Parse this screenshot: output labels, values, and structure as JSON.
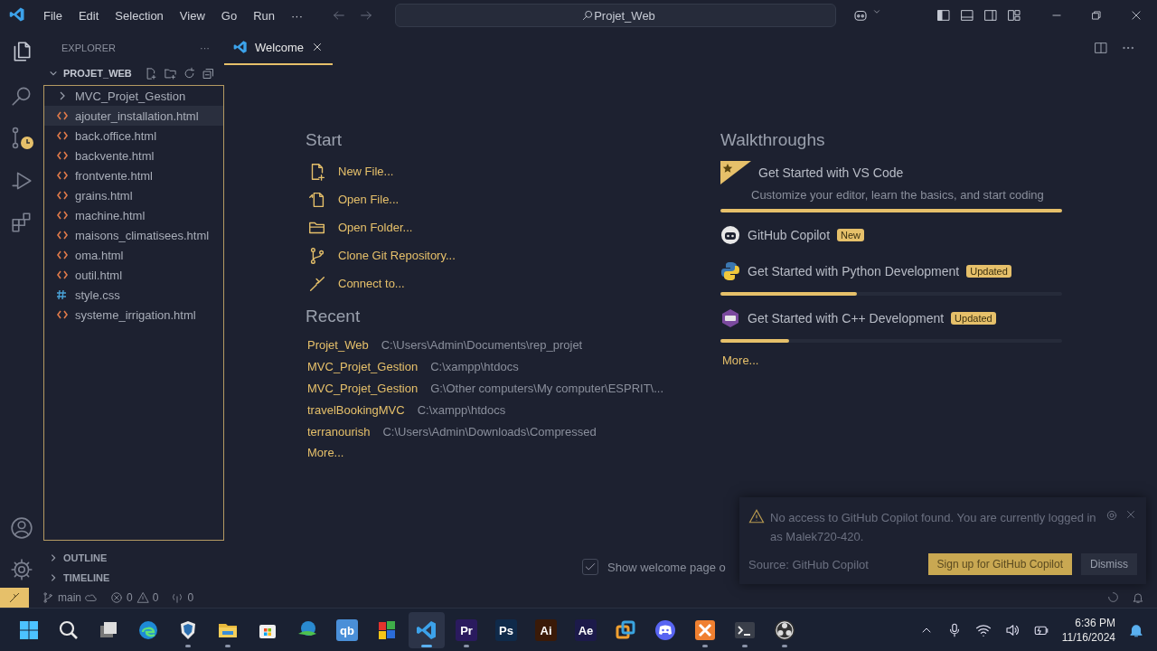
{
  "menu": [
    "File",
    "Edit",
    "Selection",
    "View",
    "Go",
    "Run",
    "···"
  ],
  "command_center": {
    "value": "Projet_Web"
  },
  "sidebar": {
    "title": "EXPLORER",
    "more": "···",
    "folder": {
      "name": "PROJET_WEB",
      "expanded": true,
      "children": [
        {
          "name": "MVC_Projet_Gestion",
          "kind": "folder",
          "expanded": false,
          "hovered": false
        },
        {
          "name": "ajouter_installation.html",
          "kind": "html",
          "hovered": true
        },
        {
          "name": "back.office.html",
          "kind": "html",
          "hovered": false
        },
        {
          "name": "backvente.html",
          "kind": "html",
          "hovered": false
        },
        {
          "name": "frontvente.html",
          "kind": "html",
          "hovered": false
        },
        {
          "name": "grains.html",
          "kind": "html",
          "hovered": false
        },
        {
          "name": "machine.html",
          "kind": "html",
          "hovered": false
        },
        {
          "name": "maisons_climatisees.html",
          "kind": "html",
          "hovered": false
        },
        {
          "name": "oma.html",
          "kind": "html",
          "hovered": false
        },
        {
          "name": "outil.html",
          "kind": "html",
          "hovered": false
        },
        {
          "name": "style.css",
          "kind": "css",
          "hovered": false
        },
        {
          "name": "systeme_irrigation.html",
          "kind": "html",
          "hovered": false
        }
      ]
    },
    "sections": [
      {
        "label": "OUTLINE",
        "expanded": false
      },
      {
        "label": "TIMELINE",
        "expanded": false
      }
    ]
  },
  "tabs": [
    {
      "label": "Welcome",
      "selected": true
    }
  ],
  "start": {
    "title": "Start",
    "items": [
      {
        "label": "New File...",
        "kind": "new-file"
      },
      {
        "label": "Open File...",
        "kind": "open-file"
      },
      {
        "label": "Open Folder...",
        "kind": "folder"
      },
      {
        "label": "Clone Git Repository...",
        "kind": "git"
      },
      {
        "label": "Connect to...",
        "kind": "remote"
      }
    ]
  },
  "recent": {
    "title": "Recent",
    "items": [
      {
        "name": "Projet_Web",
        "path": "C:\\Users\\Admin\\Documents\\rep_projet"
      },
      {
        "name": "MVC_Projet_Gestion",
        "path": "C:\\xampp\\htdocs"
      },
      {
        "name": "MVC_Projet_Gestion",
        "path": "G:\\Other computers\\My computer\\ESPRIT\\..."
      },
      {
        "name": "travelBookingMVC",
        "path": "C:\\xampp\\htdocs"
      },
      {
        "name": "terranourish",
        "path": "C:\\Users\\Admin\\Downloads\\Compressed"
      }
    ],
    "more": "More..."
  },
  "walkthroughs": {
    "title": "Walkthroughs",
    "items": [
      {
        "kind": "star",
        "title": "Get Started with VS Code",
        "description": "Customize your editor, learn the basics, and start coding",
        "level": 1
      },
      {
        "kind": "copilot",
        "title": "GitHub Copilot",
        "badge": "New"
      },
      {
        "kind": "python",
        "title": "Get Started with Python Development",
        "badge": "Updated",
        "level": 0.4
      },
      {
        "kind": "cpp",
        "title": "Get Started with C++ Development",
        "badge": "Updated",
        "level": 0.2
      }
    ],
    "more": "More..."
  },
  "welcome_checkbox": {
    "label": "Show welcome page o",
    "checked": true
  },
  "notification": {
    "message": "No access to GitHub Copilot found. You are currently logged in as Malek720-420.",
    "source": "Source: GitHub Copilot",
    "buttons": [
      "Sign up for GitHub Copilot",
      "Dismiss"
    ]
  },
  "status_bar": {
    "branch": "main",
    "errors": "0",
    "warnings": "0",
    "ports": "0"
  },
  "taskbar": {
    "apps": [
      {
        "kind": "start",
        "running": false,
        "selected": false
      },
      {
        "kind": "search",
        "running": false,
        "selected": false
      },
      {
        "kind": "windows",
        "running": false,
        "selected": false
      },
      {
        "kind": "swirl",
        "running": false,
        "selected": false
      },
      {
        "kind": "shield",
        "running": true,
        "selected": false
      },
      {
        "kind": "folder",
        "running": true,
        "selected": false
      },
      {
        "kind": "bag",
        "running": false,
        "selected": false
      },
      {
        "kind": "globe",
        "running": false,
        "selected": false
      },
      {
        "kind": "tile",
        "label": "qb",
        "color": "#4a8fd8",
        "running": false,
        "selected": false
      },
      {
        "kind": "squares",
        "running": false,
        "selected": false
      },
      {
        "kind": "code",
        "running": true,
        "selected": true
      },
      {
        "kind": "tile",
        "label": "Pr",
        "color": "#2a1a5e",
        "running": true,
        "selected": false
      },
      {
        "kind": "tile",
        "label": "Ps",
        "color": "#0f2a4a",
        "running": false,
        "selected": false
      },
      {
        "kind": "tile",
        "label": "Ai",
        "color": "#3a1a08",
        "running": false,
        "selected": false
      },
      {
        "kind": "tile",
        "label": "Ae",
        "color": "#1c1a4a",
        "running": false,
        "selected": false
      },
      {
        "kind": "boxes",
        "running": false,
        "selected": false
      },
      {
        "kind": "gamepad",
        "running": false,
        "selected": false
      },
      {
        "kind": "x-tile",
        "running": true,
        "selected": false
      },
      {
        "kind": "terminal",
        "running": true,
        "selected": false
      },
      {
        "kind": "ring",
        "running": true,
        "selected": false
      }
    ],
    "clock": {
      "time": "6:36 PM",
      "date": "11/16/2024"
    }
  }
}
